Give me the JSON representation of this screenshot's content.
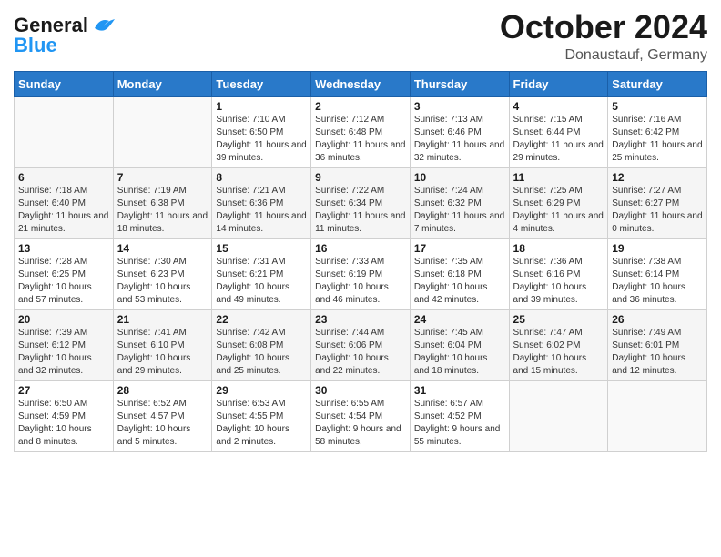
{
  "header": {
    "logo_general": "General",
    "logo_blue": "Blue",
    "month": "October 2024",
    "location": "Donaustauf, Germany"
  },
  "weekdays": [
    "Sunday",
    "Monday",
    "Tuesday",
    "Wednesday",
    "Thursday",
    "Friday",
    "Saturday"
  ],
  "weeks": [
    [
      {
        "day": "",
        "sunrise": "",
        "sunset": "",
        "daylight": ""
      },
      {
        "day": "",
        "sunrise": "",
        "sunset": "",
        "daylight": ""
      },
      {
        "day": "1",
        "sunrise": "Sunrise: 7:10 AM",
        "sunset": "Sunset: 6:50 PM",
        "daylight": "Daylight: 11 hours and 39 minutes."
      },
      {
        "day": "2",
        "sunrise": "Sunrise: 7:12 AM",
        "sunset": "Sunset: 6:48 PM",
        "daylight": "Daylight: 11 hours and 36 minutes."
      },
      {
        "day": "3",
        "sunrise": "Sunrise: 7:13 AM",
        "sunset": "Sunset: 6:46 PM",
        "daylight": "Daylight: 11 hours and 32 minutes."
      },
      {
        "day": "4",
        "sunrise": "Sunrise: 7:15 AM",
        "sunset": "Sunset: 6:44 PM",
        "daylight": "Daylight: 11 hours and 29 minutes."
      },
      {
        "day": "5",
        "sunrise": "Sunrise: 7:16 AM",
        "sunset": "Sunset: 6:42 PM",
        "daylight": "Daylight: 11 hours and 25 minutes."
      }
    ],
    [
      {
        "day": "6",
        "sunrise": "Sunrise: 7:18 AM",
        "sunset": "Sunset: 6:40 PM",
        "daylight": "Daylight: 11 hours and 21 minutes."
      },
      {
        "day": "7",
        "sunrise": "Sunrise: 7:19 AM",
        "sunset": "Sunset: 6:38 PM",
        "daylight": "Daylight: 11 hours and 18 minutes."
      },
      {
        "day": "8",
        "sunrise": "Sunrise: 7:21 AM",
        "sunset": "Sunset: 6:36 PM",
        "daylight": "Daylight: 11 hours and 14 minutes."
      },
      {
        "day": "9",
        "sunrise": "Sunrise: 7:22 AM",
        "sunset": "Sunset: 6:34 PM",
        "daylight": "Daylight: 11 hours and 11 minutes."
      },
      {
        "day": "10",
        "sunrise": "Sunrise: 7:24 AM",
        "sunset": "Sunset: 6:32 PM",
        "daylight": "Daylight: 11 hours and 7 minutes."
      },
      {
        "day": "11",
        "sunrise": "Sunrise: 7:25 AM",
        "sunset": "Sunset: 6:29 PM",
        "daylight": "Daylight: 11 hours and 4 minutes."
      },
      {
        "day": "12",
        "sunrise": "Sunrise: 7:27 AM",
        "sunset": "Sunset: 6:27 PM",
        "daylight": "Daylight: 11 hours and 0 minutes."
      }
    ],
    [
      {
        "day": "13",
        "sunrise": "Sunrise: 7:28 AM",
        "sunset": "Sunset: 6:25 PM",
        "daylight": "Daylight: 10 hours and 57 minutes."
      },
      {
        "day": "14",
        "sunrise": "Sunrise: 7:30 AM",
        "sunset": "Sunset: 6:23 PM",
        "daylight": "Daylight: 10 hours and 53 minutes."
      },
      {
        "day": "15",
        "sunrise": "Sunrise: 7:31 AM",
        "sunset": "Sunset: 6:21 PM",
        "daylight": "Daylight: 10 hours and 49 minutes."
      },
      {
        "day": "16",
        "sunrise": "Sunrise: 7:33 AM",
        "sunset": "Sunset: 6:19 PM",
        "daylight": "Daylight: 10 hours and 46 minutes."
      },
      {
        "day": "17",
        "sunrise": "Sunrise: 7:35 AM",
        "sunset": "Sunset: 6:18 PM",
        "daylight": "Daylight: 10 hours and 42 minutes."
      },
      {
        "day": "18",
        "sunrise": "Sunrise: 7:36 AM",
        "sunset": "Sunset: 6:16 PM",
        "daylight": "Daylight: 10 hours and 39 minutes."
      },
      {
        "day": "19",
        "sunrise": "Sunrise: 7:38 AM",
        "sunset": "Sunset: 6:14 PM",
        "daylight": "Daylight: 10 hours and 36 minutes."
      }
    ],
    [
      {
        "day": "20",
        "sunrise": "Sunrise: 7:39 AM",
        "sunset": "Sunset: 6:12 PM",
        "daylight": "Daylight: 10 hours and 32 minutes."
      },
      {
        "day": "21",
        "sunrise": "Sunrise: 7:41 AM",
        "sunset": "Sunset: 6:10 PM",
        "daylight": "Daylight: 10 hours and 29 minutes."
      },
      {
        "day": "22",
        "sunrise": "Sunrise: 7:42 AM",
        "sunset": "Sunset: 6:08 PM",
        "daylight": "Daylight: 10 hours and 25 minutes."
      },
      {
        "day": "23",
        "sunrise": "Sunrise: 7:44 AM",
        "sunset": "Sunset: 6:06 PM",
        "daylight": "Daylight: 10 hours and 22 minutes."
      },
      {
        "day": "24",
        "sunrise": "Sunrise: 7:45 AM",
        "sunset": "Sunset: 6:04 PM",
        "daylight": "Daylight: 10 hours and 18 minutes."
      },
      {
        "day": "25",
        "sunrise": "Sunrise: 7:47 AM",
        "sunset": "Sunset: 6:02 PM",
        "daylight": "Daylight: 10 hours and 15 minutes."
      },
      {
        "day": "26",
        "sunrise": "Sunrise: 7:49 AM",
        "sunset": "Sunset: 6:01 PM",
        "daylight": "Daylight: 10 hours and 12 minutes."
      }
    ],
    [
      {
        "day": "27",
        "sunrise": "Sunrise: 6:50 AM",
        "sunset": "Sunset: 4:59 PM",
        "daylight": "Daylight: 10 hours and 8 minutes."
      },
      {
        "day": "28",
        "sunrise": "Sunrise: 6:52 AM",
        "sunset": "Sunset: 4:57 PM",
        "daylight": "Daylight: 10 hours and 5 minutes."
      },
      {
        "day": "29",
        "sunrise": "Sunrise: 6:53 AM",
        "sunset": "Sunset: 4:55 PM",
        "daylight": "Daylight: 10 hours and 2 minutes."
      },
      {
        "day": "30",
        "sunrise": "Sunrise: 6:55 AM",
        "sunset": "Sunset: 4:54 PM",
        "daylight": "Daylight: 9 hours and 58 minutes."
      },
      {
        "day": "31",
        "sunrise": "Sunrise: 6:57 AM",
        "sunset": "Sunset: 4:52 PM",
        "daylight": "Daylight: 9 hours and 55 minutes."
      },
      {
        "day": "",
        "sunrise": "",
        "sunset": "",
        "daylight": ""
      },
      {
        "day": "",
        "sunrise": "",
        "sunset": "",
        "daylight": ""
      }
    ]
  ]
}
